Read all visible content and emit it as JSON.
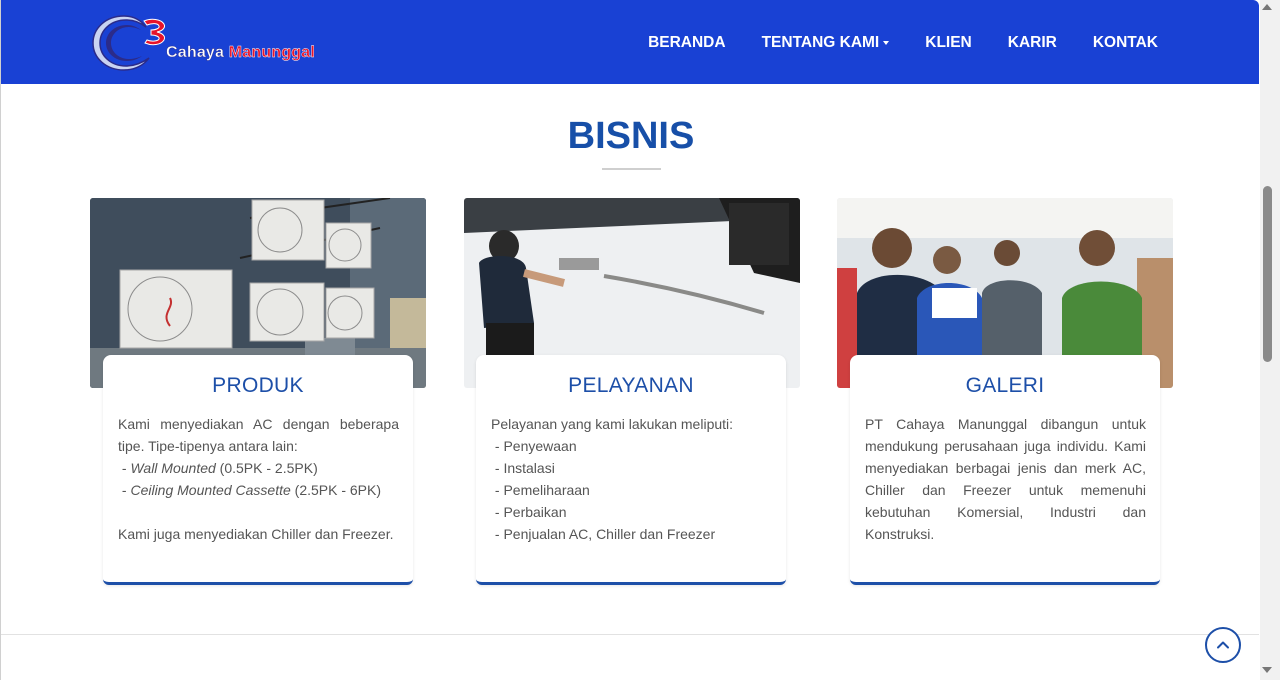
{
  "brand": {
    "name_part1": "Cahaya",
    "name_part2": "Manunggal",
    "logo_icon": "crescent-logo-icon",
    "colors": {
      "navbar": "#1941d4",
      "accent": "#174fa8",
      "logo_red": "#e8132b"
    }
  },
  "nav": {
    "items": [
      {
        "label": "BERANDA"
      },
      {
        "label": "TENTANG KAMI",
        "has_dropdown": true
      },
      {
        "label": "KLIEN"
      },
      {
        "label": "KARIR"
      },
      {
        "label": "KONTAK"
      }
    ]
  },
  "section": {
    "title": "BISNIS"
  },
  "cards": [
    {
      "title": "PRODUK",
      "image": "outdoor-ac-units-photo",
      "intro": "Kami menyediakan AC dengan beberapa tipe. Tipe-tipenya antara lain:",
      "items": [
        {
          "italic": "Wall Mounted",
          "rest": " (0.5PK - 2.5PK)"
        },
        {
          "italic": "Ceiling Mounted Cassette",
          "rest": " (2.5PK - 6PK)"
        }
      ],
      "outro": "Kami juga menyediakan Chiller dan Freezer."
    },
    {
      "title": "PELAYANAN",
      "image": "technician-installing-ac-photo",
      "intro": "Pelayanan yang kami lakukan meliputi:",
      "items": [
        "Penyewaan",
        "Instalasi",
        "Pemeliharaan",
        "Perbaikan",
        "Penjualan AC, Chiller dan Freezer"
      ]
    },
    {
      "title": "GALERI",
      "image": "team-meeting-photo",
      "text": "PT Cahaya Manunggal dibangun untuk mendukung perusahaan juga individu. Kami menyediakan berbagai jenis dan merk AC, Chiller dan Freezer untuk memenuhi kebutuhan Komersial, Industri dan Konstruksi."
    }
  ],
  "controls": {
    "back_to_top_icon": "chevron-up-icon"
  }
}
